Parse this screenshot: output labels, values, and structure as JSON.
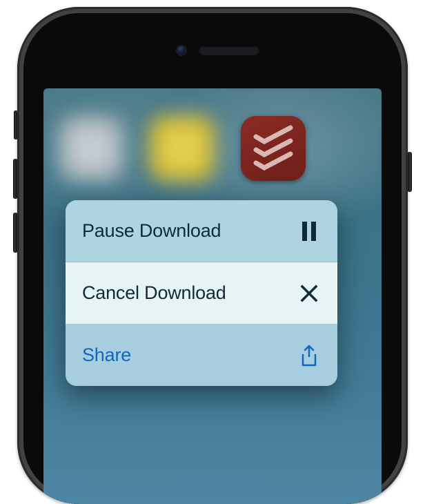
{
  "home_icons": [
    {
      "name": "blurred-app-1"
    },
    {
      "name": "blurred-app-2"
    },
    {
      "name": "todoist-app"
    }
  ],
  "quick_actions": {
    "items": [
      {
        "label": "Pause Download",
        "icon": "pause-icon"
      },
      {
        "label": "Cancel Download",
        "icon": "close-icon"
      },
      {
        "label": "Share",
        "icon": "share-icon"
      }
    ]
  }
}
